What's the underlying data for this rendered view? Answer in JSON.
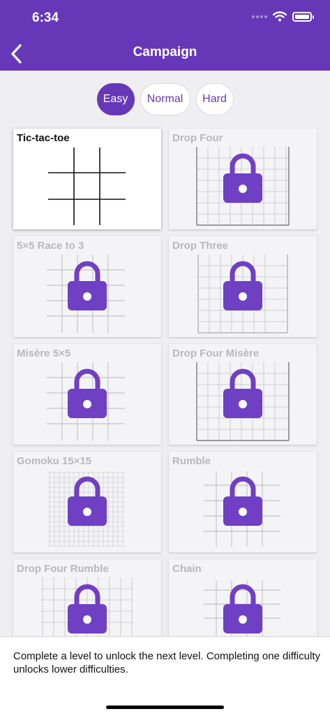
{
  "status_bar": {
    "time": "6:34"
  },
  "nav": {
    "title": "Campaign"
  },
  "difficulty": {
    "easy": "Easy",
    "normal": "Normal",
    "hard": "Hard",
    "selected": "Easy"
  },
  "levels": [
    {
      "title": "Tic-tac-toe",
      "locked": false
    },
    {
      "title": "Drop Four",
      "locked": true
    },
    {
      "title": "5×5 Race to 3",
      "locked": true
    },
    {
      "title": "Drop Three",
      "locked": true
    },
    {
      "title": "Misère 5×5",
      "locked": true
    },
    {
      "title": "Drop Four Misère",
      "locked": true
    },
    {
      "title": "Gomoku 15×15",
      "locked": true
    },
    {
      "title": "Rumble",
      "locked": true
    },
    {
      "title": "Drop Four Rumble",
      "locked": true
    },
    {
      "title": "Chain",
      "locked": true
    }
  ],
  "footer": {
    "message": "Complete a level to unlock the next level. Completing one difficulty unlocks lower difficulties."
  },
  "colors": {
    "accent": "#6638b8",
    "lock": "#6f3fc4",
    "locked_title": "#b9b9bd"
  }
}
